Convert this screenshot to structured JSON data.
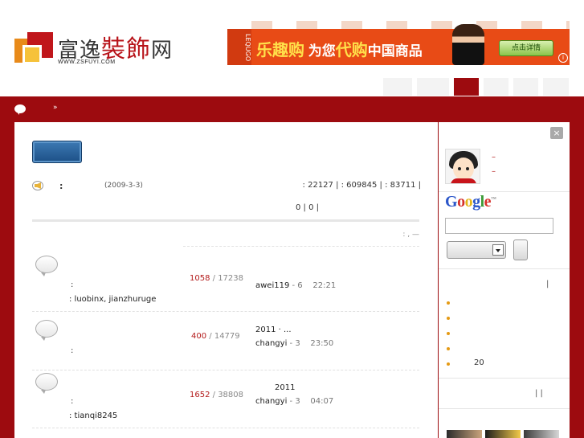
{
  "header": {
    "logo": {
      "name_part1": "富逸",
      "name_part2": "裝飾",
      "name_part3": "网",
      "url": "WWW.ZSFUYI.COM"
    },
    "banner": {
      "ribbon": "LEQUGO",
      "brand": "乐趣购",
      "text1": "为您",
      "text2": "代购",
      "text3": "中国商品",
      "cta": "点击详情",
      "info": "i"
    }
  },
  "colors": {
    "brand_red": "#9d0b0f",
    "hot_count": "#b31a1a",
    "bullet": "#e59a14",
    "button_blue": "#2a62a0"
  },
  "breadcrumb": {
    "icon": "speech-bubble-icon",
    "separator": "»"
  },
  "notice": {
    "icon": "speaker-icon",
    "label": ":",
    "date": "(2009-3-3)",
    "stats": ": 22127 |   : 609845 |   : 83711 |",
    "stats2": "0 |    0 |"
  },
  "forum_header": ":   ,    —",
  "forums": [
    {
      "icon": "forum-bubble-icon",
      "colon": ":",
      "moderators": ": luobinx, jianzhuruge",
      "threads": "1058",
      "posts": "/ 17238",
      "title": "",
      "last_user": "awei119",
      "last_sep": "- 6",
      "last_time": "22:21"
    },
    {
      "icon": "forum-bubble-icon",
      "colon": ":",
      "moderators": "",
      "threads": "400",
      "posts": "/ 14779",
      "title": "2011 ·          ...",
      "last_user": "changyi",
      "last_sep": "- 3",
      "last_time": "23:50"
    },
    {
      "icon": "forum-bubble-icon",
      "colon": ":",
      "moderators": ": tianqi8245",
      "threads": "1652",
      "posts": "/ 38808",
      "title": "2011",
      "last_user": "changyi",
      "last_sep": "- 3",
      "last_time": "04:07"
    }
  ],
  "sidebar": {
    "close": "×",
    "user_dash1": "–",
    "user_dash2": "–",
    "search": {
      "placeholder": "",
      "select_value": ""
    },
    "pipe1": "|",
    "bullet_count": "20",
    "pipe2": "|    |"
  }
}
